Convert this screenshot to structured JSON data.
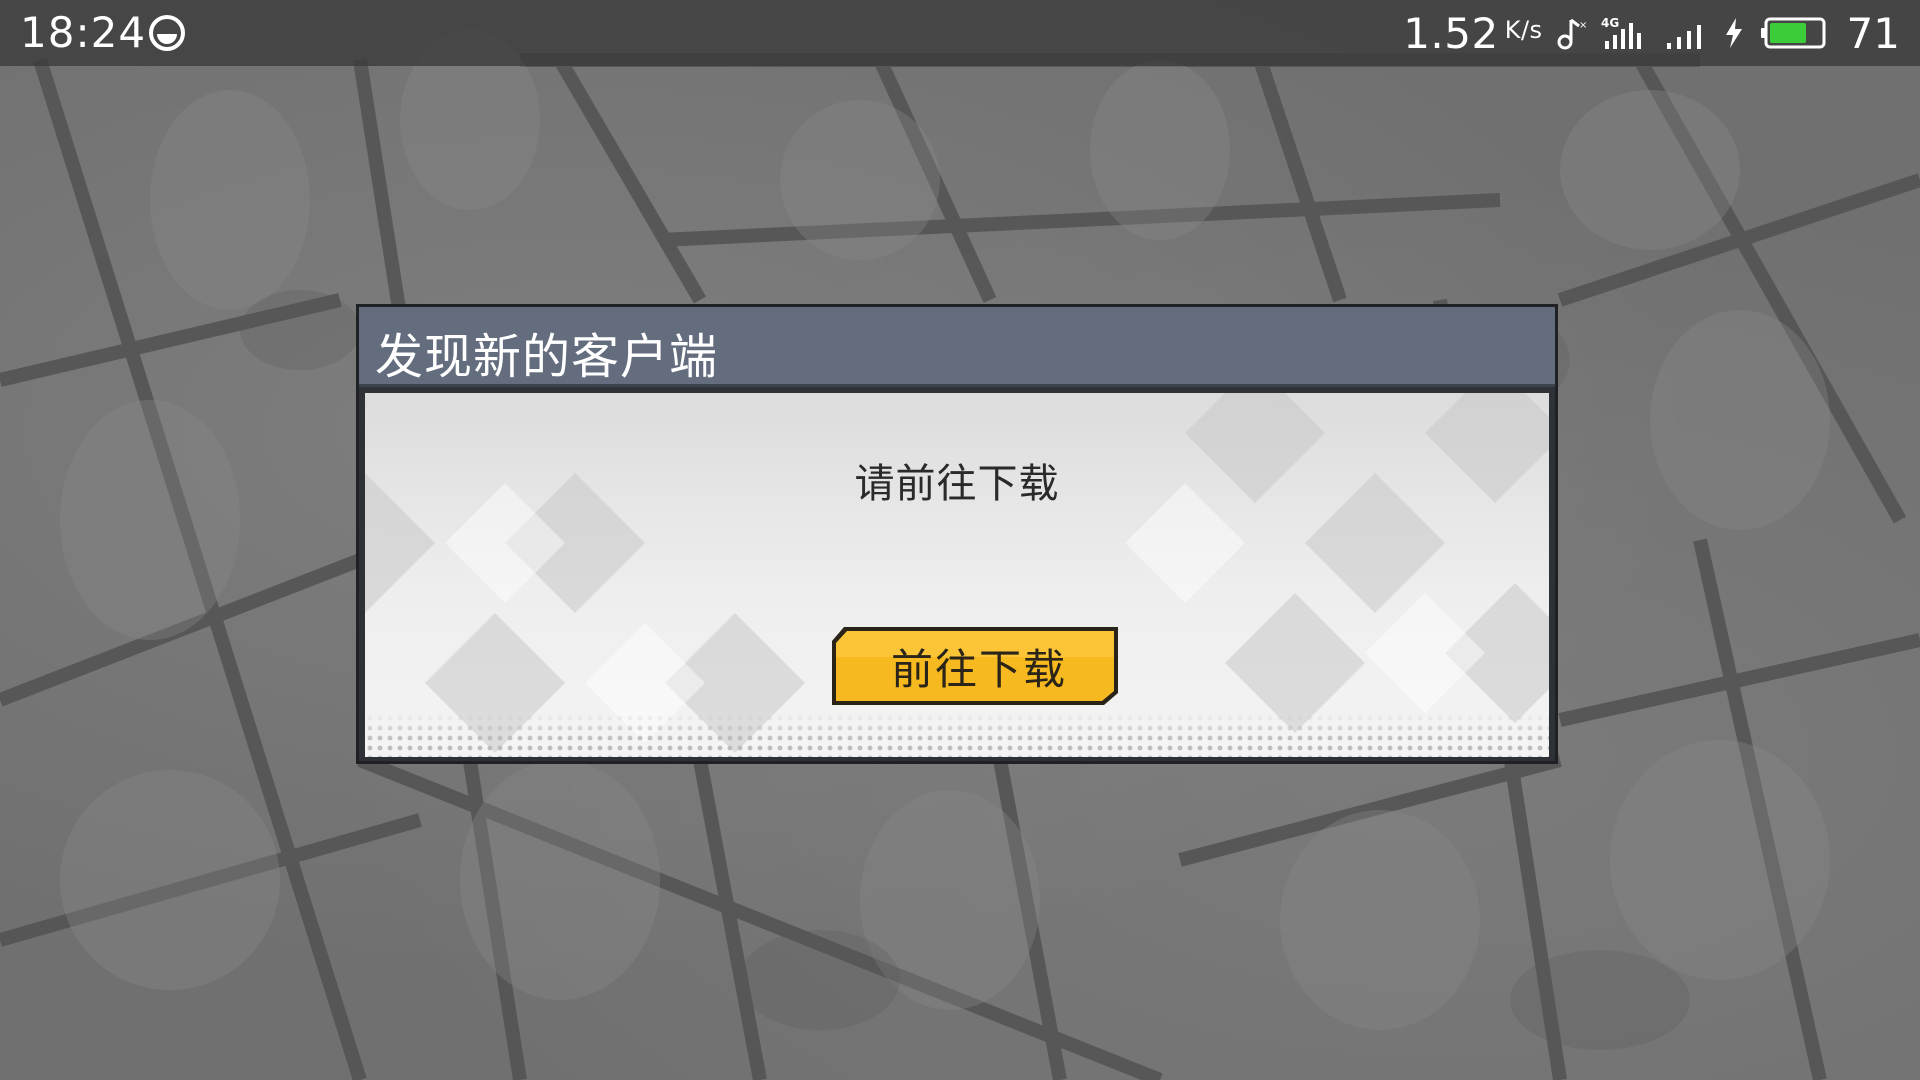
{
  "status_bar": {
    "time": "18:24",
    "app_icon": "sync-circle-icon",
    "net_speed": "1.52",
    "net_speed_unit": "K/s",
    "icons": [
      "music-note-icon",
      "4g-signal-icon",
      "cellular-signal-icon",
      "charging-bolt-icon",
      "battery-icon"
    ],
    "network_type": "4G",
    "battery_level": "71",
    "battery_fraction": 0.71,
    "battery_color": "#3ccc3a"
  },
  "dialog": {
    "title": "发现新的客户端",
    "message": "请前往下载",
    "button_label": "前往下载",
    "header_color": "#636d7e",
    "button_color": "#f6b91f"
  }
}
